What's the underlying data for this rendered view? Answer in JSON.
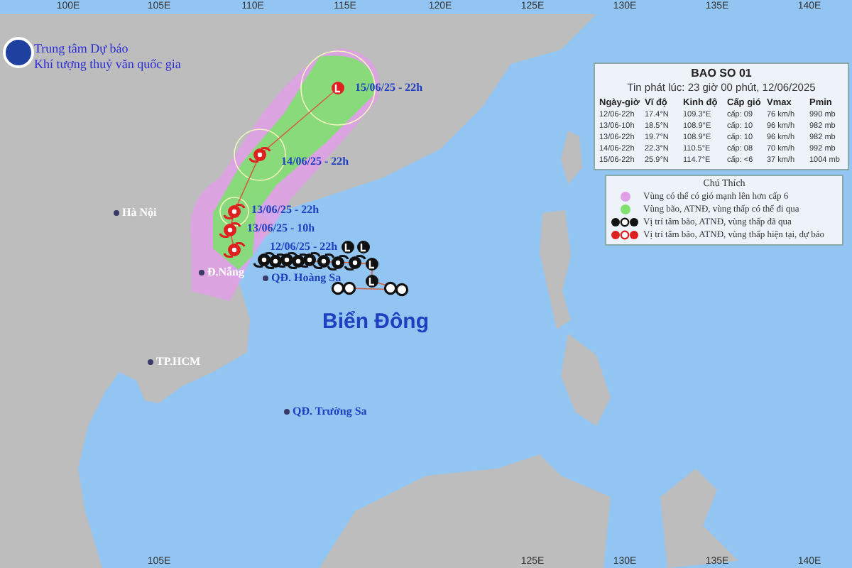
{
  "axis": {
    "top_ticks": [
      "100E",
      "105E",
      "110E",
      "115E",
      "120E",
      "125E",
      "130E",
      "135E",
      "140E"
    ],
    "bottom_ticks": [
      "105E",
      "125E",
      "130E",
      "135E",
      "140E"
    ]
  },
  "agency": {
    "line_1": "Trung tâm Dự báo",
    "line_2": "Khí tượng thuỷ văn quốc gia"
  },
  "bulletin": {
    "title": "BAO SO 01",
    "issued": "Tin phát lúc: 23 giờ 00 phút, 12/06/2025",
    "columns": [
      "Ngày-giờ",
      "Vĩ độ",
      "Kinh độ",
      "Cấp gió",
      "Vmax",
      "Pmin"
    ],
    "rows": [
      [
        "12/06-22h",
        "17.4°N",
        "109.3°E",
        "cấp: 09",
        "76 km/h",
        "990 mb"
      ],
      [
        "13/06-10h",
        "18.5°N",
        "108.9°E",
        "cấp: 10",
        "96 km/h",
        "982 mb"
      ],
      [
        "13/06-22h",
        "19.7°N",
        "108.9°E",
        "cấp: 10",
        "96 km/h",
        "982 mb"
      ],
      [
        "14/06-22h",
        "22.3°N",
        "110.5°E",
        "cấp: 08",
        "70 km/h",
        "992 mb"
      ],
      [
        "15/06-22h",
        "25.9°N",
        "114.7°E",
        "cấp: <6",
        "37 km/h",
        "1004 mb"
      ]
    ]
  },
  "legend": {
    "title": "Chú Thích",
    "items": [
      {
        "kind": "zone",
        "color": "#e0a0e8",
        "label": "Vùng có thể có gió mạnh lên hơn cấp 6"
      },
      {
        "kind": "zone",
        "color": "#80e070",
        "label": "Vùng bão, ATNĐ, vùng thấp có thể đi qua"
      },
      {
        "kind": "symbols",
        "color": "#111111",
        "label": "Vị trí tâm bão, ATNĐ, vùng thấp đã qua"
      },
      {
        "kind": "symbols",
        "color": "#e02020",
        "label": "Vị trí tâm bão, ATNĐ, vùng thấp hiện tại, dự báo"
      }
    ]
  },
  "places": [
    {
      "name": "Hà Nội",
      "kind": "city"
    },
    {
      "name": "Đ.Nẵng",
      "kind": "city"
    },
    {
      "name": "QĐ. Hoàng Sa",
      "kind": "island"
    },
    {
      "name": "TP.HCM",
      "kind": "city"
    },
    {
      "name": "QĐ. Trường Sa",
      "kind": "island"
    }
  ],
  "sea_label": "Biển Đông",
  "track_labels": [
    "15/06/25 - 22h",
    "14/06/25 - 22h",
    "13/06/25 - 22h",
    "13/06/25 - 10h",
    "12/06/25 - 22h"
  ]
}
